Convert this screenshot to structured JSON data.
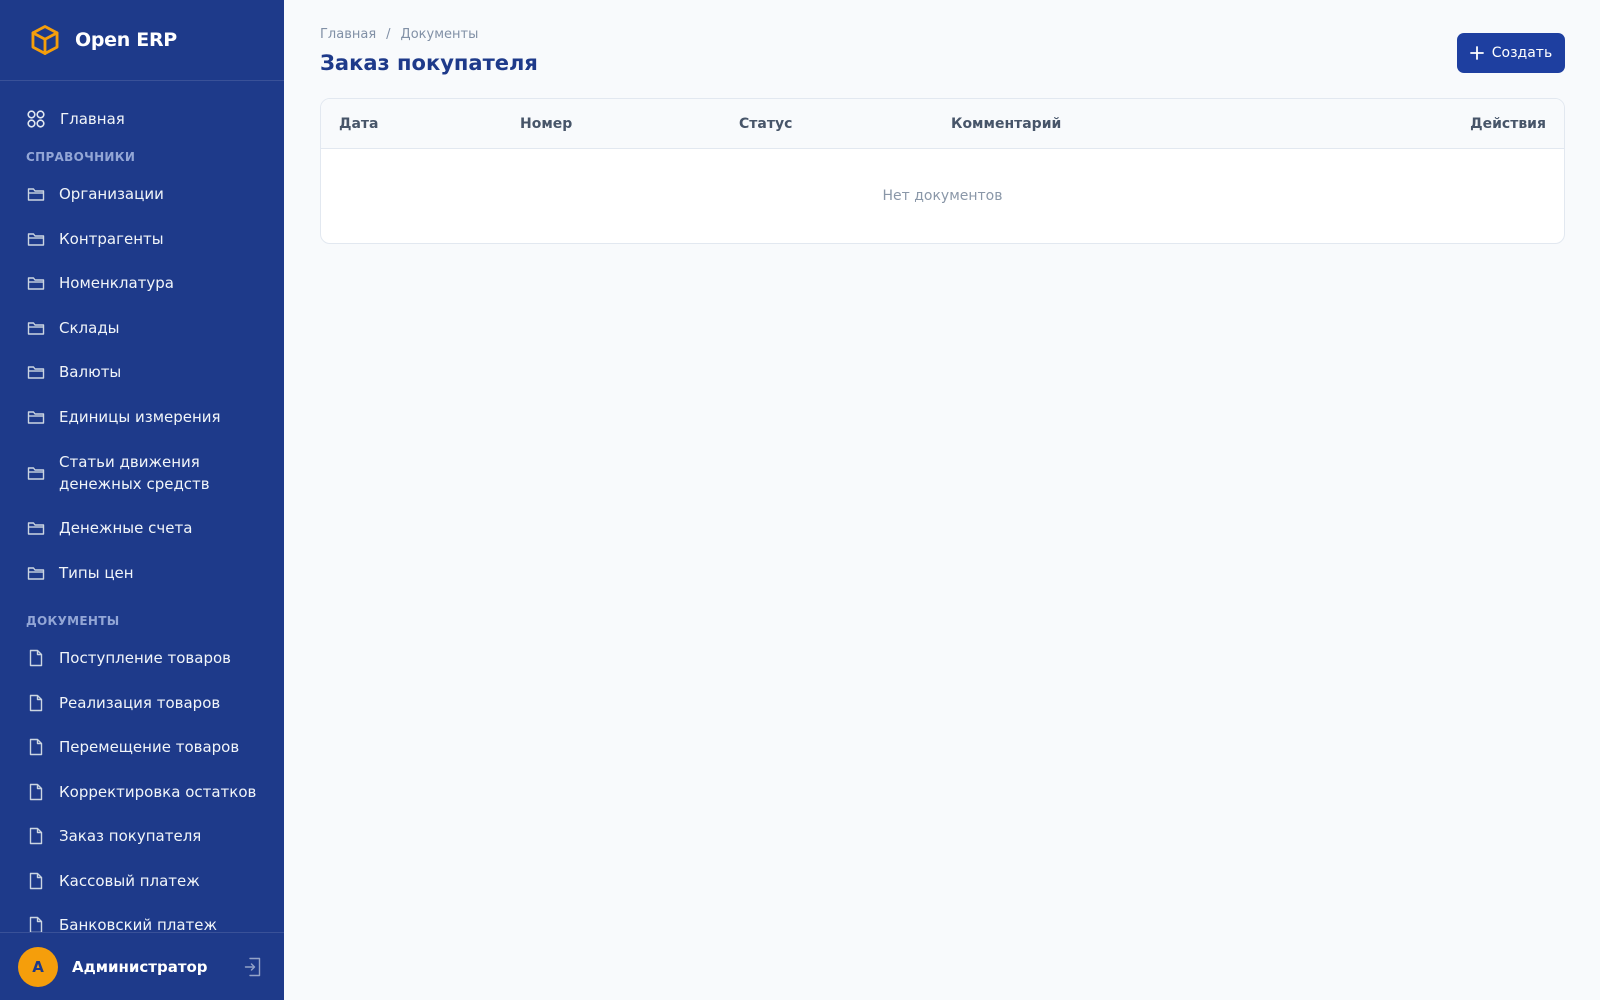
{
  "app": {
    "title": "Open ERP"
  },
  "sidebar": {
    "home": {
      "label": "Главная"
    },
    "sections": {
      "catalogs": {
        "title": "СПРАВОЧНИКИ",
        "items": [
          "Организации",
          "Контрагенты",
          "Номенклатура",
          "Склады",
          "Валюты",
          "Единицы измерения",
          "Статьи движения денежных средств",
          "Денежные счета",
          "Типы цен"
        ]
      },
      "documents": {
        "title": "ДОКУМЕНТЫ",
        "items": [
          "Поступление товаров",
          "Реализация товаров",
          "Перемещение товаров",
          "Корректировка остатков",
          "Заказ покупателя",
          "Кассовый платеж",
          "Банковский платеж"
        ]
      }
    }
  },
  "user": {
    "initial": "А",
    "name": "Администратор"
  },
  "breadcrumb": {
    "home": "Главная",
    "separator": "/",
    "current": "Документы"
  },
  "page": {
    "title": "Заказ покупателя"
  },
  "toolbar": {
    "create_label": "Создать"
  },
  "table": {
    "columns": {
      "date": "Дата",
      "number": "Номер",
      "status": "Статус",
      "comment": "Комментарий",
      "actions": "Действия"
    },
    "empty_text": "Нет документов"
  },
  "colors": {
    "sidebar": "#1e3a8a",
    "accent": "#1e3fa0",
    "logo": "#f59e0b",
    "avatar": "#f59e0b"
  }
}
